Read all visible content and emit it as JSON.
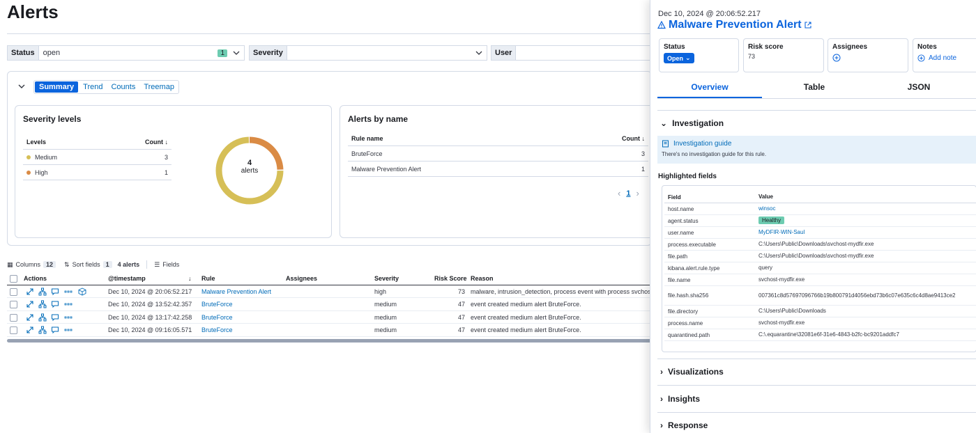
{
  "page": {
    "title": "Alerts"
  },
  "filters": [
    {
      "label": "Status",
      "value": "open",
      "count": "1"
    },
    {
      "label": "Severity",
      "value": ""
    },
    {
      "label": "User",
      "value": ""
    }
  ],
  "viz_tabs": [
    "Summary",
    "Trend",
    "Counts",
    "Treemap"
  ],
  "severity_card": {
    "title": "Severity levels",
    "col_levels": "Levels",
    "col_count": "Count",
    "rows": [
      {
        "level": "Medium",
        "count": "3",
        "color": "#d6bf57"
      },
      {
        "level": "High",
        "count": "1",
        "color": "#da8b45"
      }
    ],
    "donut_total": "4",
    "donut_unit": "alerts"
  },
  "chart_data": {
    "type": "pie",
    "categories": [
      "Medium",
      "High"
    ],
    "values": [
      3,
      1
    ],
    "colors": [
      "#d6bf57",
      "#da8b45"
    ],
    "title": "Severity levels"
  },
  "name_card": {
    "title": "Alerts by name",
    "col_rule": "Rule name",
    "col_count": "Count",
    "rows": [
      {
        "name": "BruteForce",
        "count": "3"
      },
      {
        "name": "Malware Prevention Alert",
        "count": "1"
      }
    ],
    "page": "1"
  },
  "toolbar": {
    "columns_label": "Columns",
    "columns_count": "12",
    "sort_label": "Sort fields",
    "sort_count": "1",
    "alerts_count": "4 alerts",
    "fields_label": "Fields"
  },
  "grid": {
    "headers": {
      "actions": "Actions",
      "timestamp": "@timestamp",
      "rule": "Rule",
      "assignees": "Assignees",
      "severity": "Severity",
      "risk": "Risk Score",
      "reason": "Reason"
    },
    "rows": [
      {
        "timestamp": "Dec 10, 2024 @ 20:06:52.217",
        "rule": "Malware Prevention Alert",
        "severity": "high",
        "risk": "73",
        "reason": "malware, intrusion_detection, process event with process svchost-m"
      },
      {
        "timestamp": "Dec 10, 2024 @ 13:52:42.357",
        "rule": "BruteForce",
        "severity": "medium",
        "risk": "47",
        "reason": "event created medium alert BruteForce."
      },
      {
        "timestamp": "Dec 10, 2024 @ 13:17:42.258",
        "rule": "BruteForce",
        "severity": "medium",
        "risk": "47",
        "reason": "event created medium alert BruteForce."
      },
      {
        "timestamp": "Dec 10, 2024 @ 09:16:05.571",
        "rule": "BruteForce",
        "severity": "medium",
        "risk": "47",
        "reason": "event created medium alert BruteForce."
      }
    ]
  },
  "flyout": {
    "date": "Dec 10, 2024 @ 20:06:52.217",
    "title": "Malware Prevention Alert",
    "status_label": "Status",
    "status_value": "Open",
    "risk_label": "Risk score",
    "risk_value": "73",
    "assignees_label": "Assignees",
    "notes_label": "Notes",
    "add_note": "Add note",
    "tabs": [
      "Overview",
      "Table",
      "JSON"
    ],
    "investigation": "Investigation",
    "guide_link": "Investigation guide",
    "guide_desc": "There's no investigation guide for this rule.",
    "highlighted_title": "Highlighted fields",
    "col_field": "Field",
    "col_value": "Value",
    "fields": [
      {
        "field": "host.name",
        "value": "winsoc",
        "kind": "link"
      },
      {
        "field": "agent.status",
        "value": "Healthy",
        "kind": "badge"
      },
      {
        "field": "user.name",
        "value": "MyDFIR-WIN-Saul",
        "kind": "link"
      },
      {
        "field": "process.executable",
        "value": "C:\\Users\\Public\\Downloads\\svchost-mydfir.exe",
        "kind": "text"
      },
      {
        "field": "file.path",
        "value": "C:\\Users\\Public\\Downloads\\svchost-mydfir.exe",
        "kind": "text"
      },
      {
        "field": "kibana.alert.rule.type",
        "value": "query",
        "kind": "text"
      },
      {
        "field": "file.name",
        "value": "svchost-mydfir.exe",
        "kind": "text"
      },
      {
        "field": "file.hash.sha256",
        "value": "007361c8d57697096766b19b800791d4056ebd73b6c07e635c6c4d8ae9413ce2",
        "kind": "text"
      },
      {
        "field": "file.directory",
        "value": "C:\\Users\\Public\\Downloads",
        "kind": "text"
      },
      {
        "field": "process.name",
        "value": "svchost-mydfir.exe",
        "kind": "text"
      },
      {
        "field": "quarantined.path",
        "value": "C:\\.equarantine\\32081e6f-31e6-4843-b2fc-bc9201addfc7",
        "kind": "text"
      }
    ],
    "sections": [
      "Visualizations",
      "Insights",
      "Response"
    ]
  }
}
